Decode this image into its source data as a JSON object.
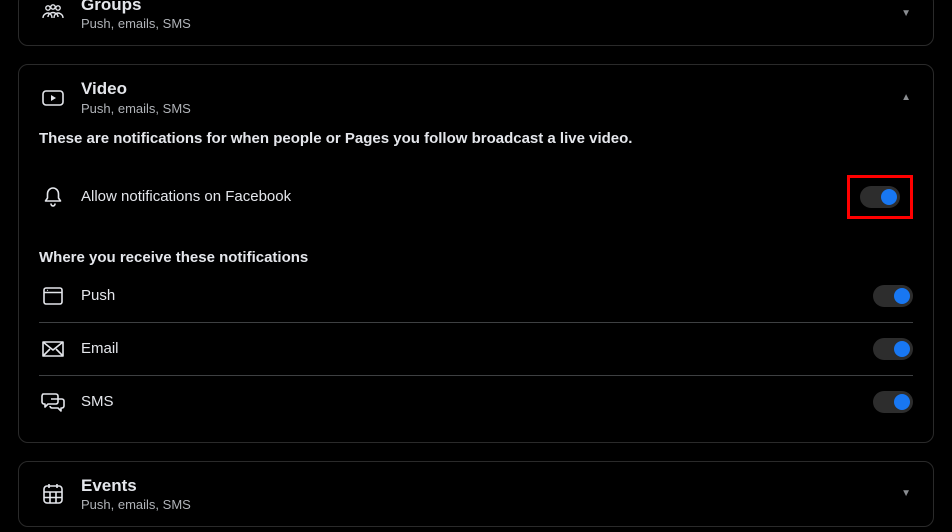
{
  "sections": {
    "groups": {
      "title": "Groups",
      "subtitle": "Push, emails, SMS"
    },
    "video": {
      "title": "Video",
      "subtitle": "Push, emails, SMS",
      "description": "These are notifications for when people or Pages you follow broadcast a live video.",
      "allow_label": "Allow notifications on Facebook",
      "where_heading": "Where you receive these notifications",
      "channels": {
        "push": "Push",
        "email": "Email",
        "sms": "SMS"
      }
    },
    "events": {
      "title": "Events",
      "subtitle": "Push, emails, SMS"
    }
  }
}
